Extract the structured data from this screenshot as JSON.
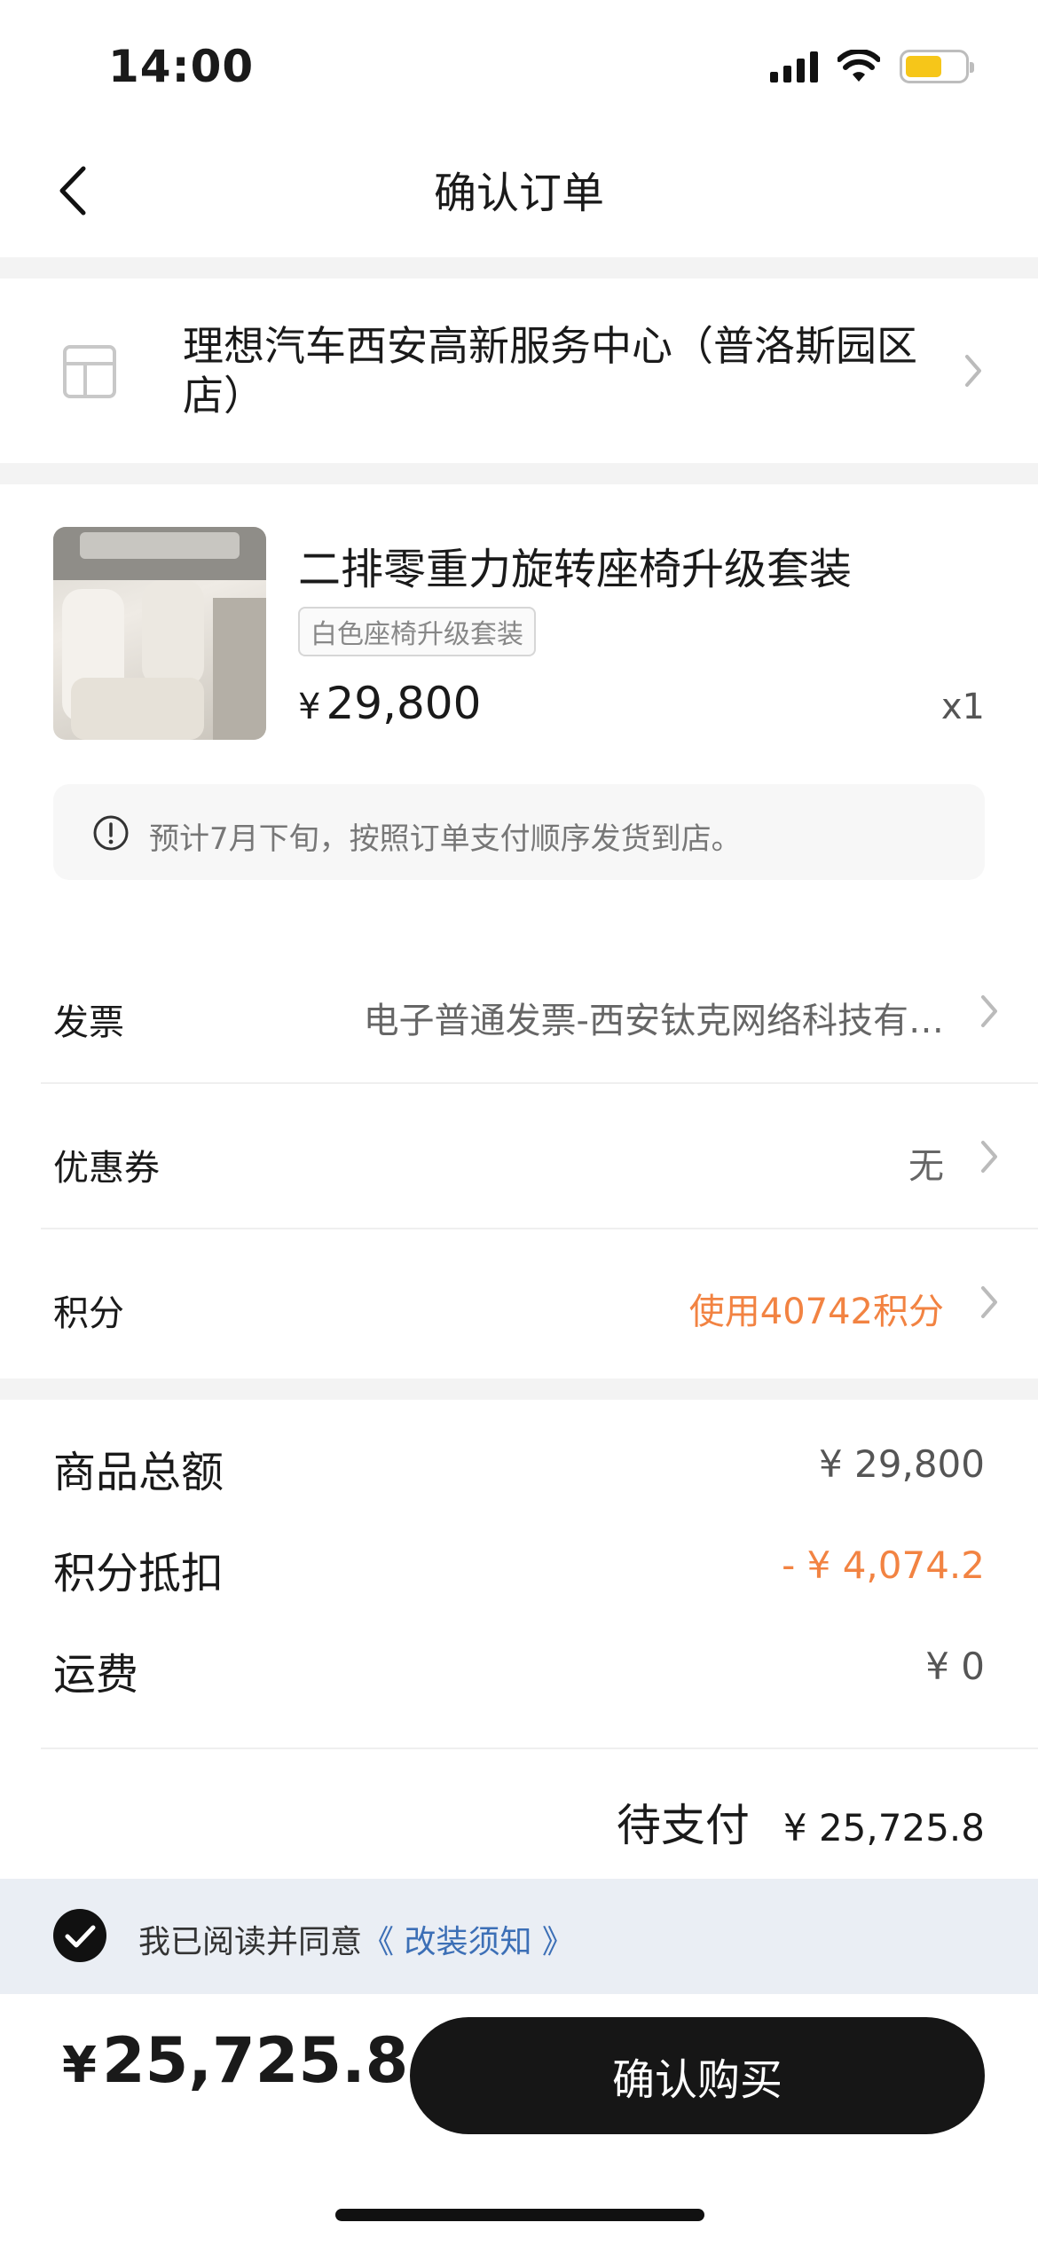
{
  "status_bar": {
    "time": "14:00"
  },
  "nav": {
    "title": "确认订单",
    "back_icon": "chevron-left-icon"
  },
  "store": {
    "name": "理想汽车西安高新服务中心（普洛斯园区店）",
    "icon": "store-icon"
  },
  "product": {
    "name": "二排零重力旋转座椅升级套装",
    "tag": "白色座椅升级套装",
    "currency": "¥",
    "price": "29,800",
    "quantity": "x1",
    "notice": "预计7月下旬，按照订单支付顺序发货到店。"
  },
  "options": [
    {
      "label": "发票",
      "value": "电子普通发票-西安钛克网络科技有…"
    },
    {
      "label": "优惠券",
      "value": "无"
    },
    {
      "label": "积分",
      "value": "使用40742积分"
    }
  ],
  "summary": {
    "rows": [
      {
        "label": "商品总额",
        "value": "¥ 29,800"
      },
      {
        "label": "积分抵扣",
        "value": "- ¥ 4,074.2"
      },
      {
        "label": "运费",
        "value": "¥ 0"
      }
    ],
    "total_label": "待支付",
    "total_value": "¥ 25,725.8"
  },
  "agreement": {
    "checked": true,
    "text": "我已阅读并同意",
    "link": "《 改装须知 》"
  },
  "bottom": {
    "currency": "¥",
    "amount": "25,725.8",
    "buy_label": "确认购买"
  },
  "colors": {
    "accent_orange": "#f28342",
    "link_blue": "#3c6fb6",
    "battery": "#f6c619",
    "button": "#161616"
  }
}
